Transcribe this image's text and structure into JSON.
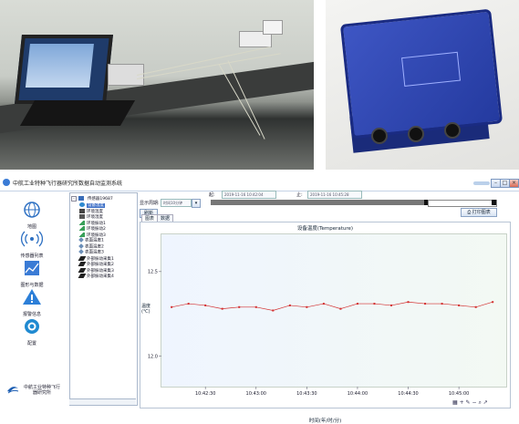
{
  "window": {
    "title": "中航工业特种飞行器研究所数据自动监测系统",
    "controls": [
      "–",
      "□",
      "×"
    ]
  },
  "nav": {
    "items": [
      {
        "label": "地图",
        "icon": "globe-icon"
      },
      {
        "label": "传感器列表",
        "icon": "wireless-sensor-icon"
      },
      {
        "label": "图形与数据",
        "icon": "chart-image-icon"
      },
      {
        "label": "报警信息",
        "icon": "warning-icon"
      },
      {
        "label": "配置",
        "icon": "settings-eye-icon"
      }
    ],
    "brand": "中航工业特种飞行器研究所"
  },
  "tree": {
    "root": "传感器19687",
    "items": [
      {
        "label": "设备温度",
        "icon": "globe-small-icon",
        "selected": true
      },
      {
        "label": "环境温度",
        "icon": "thermometer-icon"
      },
      {
        "label": "环境湿度",
        "icon": "humidity-icon"
      },
      {
        "label": "环境振动1",
        "icon": "triangle-sensor-icon"
      },
      {
        "label": "环境振动2",
        "icon": "triangle-sensor-icon"
      },
      {
        "label": "环境振动3",
        "icon": "triangle-sensor-icon"
      },
      {
        "label": "表面温度1",
        "icon": "diamond-sensor-icon"
      },
      {
        "label": "表面温度2",
        "icon": "diamond-sensor-icon"
      },
      {
        "label": "表面温度3",
        "icon": "diamond-sensor-icon"
      },
      {
        "label": "外部振动采集1",
        "icon": "probe-icon"
      },
      {
        "label": "外部振动采集2",
        "icon": "probe-icon"
      },
      {
        "label": "外部振动采集3",
        "icon": "probe-icon"
      },
      {
        "label": "外部振动采集4",
        "icon": "probe-icon"
      }
    ]
  },
  "controls": {
    "display_range_label": "显示周期:",
    "display_range_value": "时间10分钟",
    "refresh_button": "刷新",
    "start_label": "起:",
    "start_value": "2019-11-16 10:42:04",
    "end_label": "止:",
    "end_value": "2019-11-16 10:45:28",
    "print_button": "打印图表",
    "tabs": [
      "图表",
      "数据"
    ]
  },
  "chart_data": {
    "type": "line",
    "title": "设备温度(Temperature)",
    "xlabel": "时间(年/时/分)",
    "ylabel": "温度(℃)",
    "x": [
      "10:42:10",
      "10:42:20",
      "10:42:30",
      "10:42:40",
      "10:42:50",
      "10:43:00",
      "10:43:10",
      "10:43:20",
      "10:43:30",
      "10:43:40",
      "10:43:50",
      "10:44:00",
      "10:44:10",
      "10:44:20",
      "10:44:30",
      "10:44:40",
      "10:44:50",
      "10:45:00",
      "10:45:10",
      "10:45:20"
    ],
    "series": [
      {
        "values": [
          12.29,
          12.31,
          12.3,
          12.28,
          12.29,
          12.29,
          12.27,
          12.3,
          12.29,
          12.31,
          12.28,
          12.31,
          12.31,
          12.3,
          12.32,
          12.31,
          12.31,
          12.3,
          12.29,
          12.32
        ],
        "color": "#d32f2f"
      }
    ],
    "xticks": [
      "10:42:30",
      "10:43:00",
      "10:43:30",
      "10:44:00",
      "10:44:30",
      "10:45:00"
    ],
    "yticks": [
      12.0,
      12.5
    ],
    "ylim": [
      11.82,
      12.72
    ],
    "grid": false
  },
  "colors": {
    "accent": "#3d6fc6",
    "line": "#d32f2f"
  }
}
